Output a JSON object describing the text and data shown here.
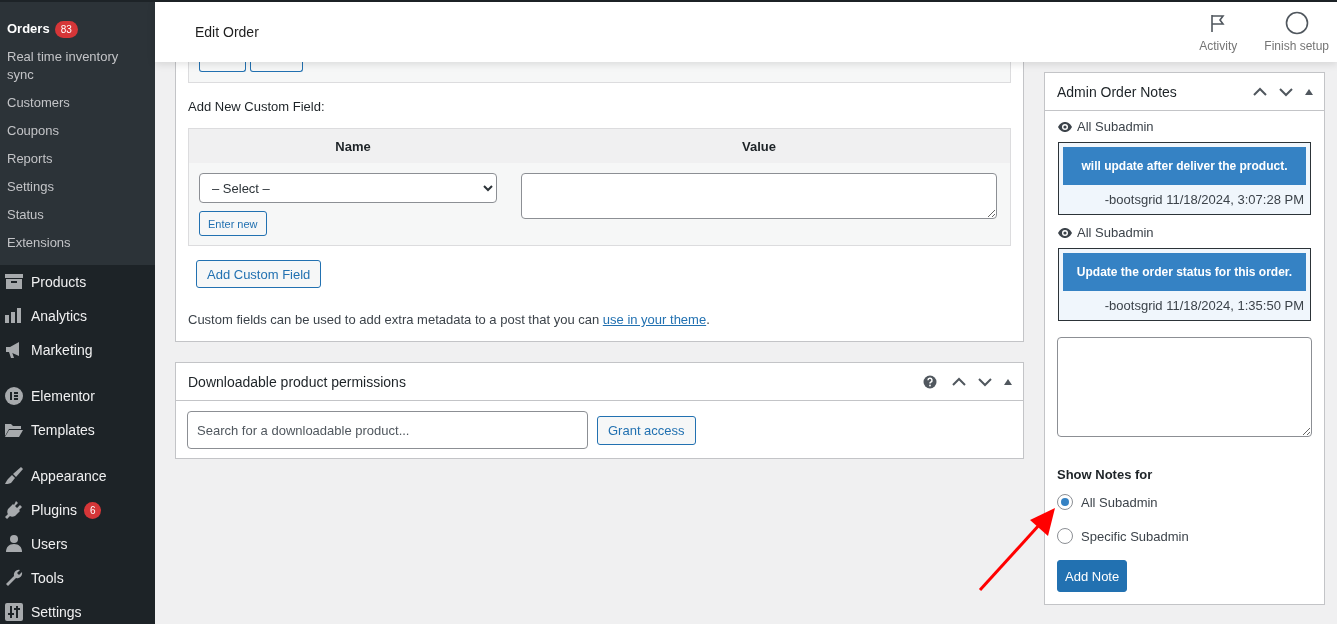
{
  "sidebar": {
    "submenu": [
      {
        "label": "Orders",
        "selected": true,
        "badge": "83"
      },
      {
        "label": "Real time inventory sync",
        "selected": false
      },
      {
        "label": "Customers",
        "selected": false
      },
      {
        "label": "Coupons",
        "selected": false
      },
      {
        "label": "Reports",
        "selected": false
      },
      {
        "label": "Settings",
        "selected": false
      },
      {
        "label": "Status",
        "selected": false
      },
      {
        "label": "Extensions",
        "selected": false
      }
    ],
    "menu_groups": [
      [
        {
          "label": "Products"
        },
        {
          "label": "Analytics"
        },
        {
          "label": "Marketing"
        }
      ],
      [
        {
          "label": "Elementor"
        },
        {
          "label": "Templates"
        }
      ],
      [
        {
          "label": "Appearance"
        },
        {
          "label": "Plugins",
          "badge": "6"
        },
        {
          "label": "Users"
        },
        {
          "label": "Tools"
        },
        {
          "label": "Settings"
        }
      ]
    ]
  },
  "header": {
    "title": "Edit Order",
    "actions": [
      {
        "label": "Activity"
      },
      {
        "label": "Finish setup"
      }
    ]
  },
  "custom_fields": {
    "heading": "Add New Custom Field:",
    "columns": [
      "Name",
      "Value"
    ],
    "select": {
      "value": "– Select –"
    },
    "enter_new": "Enter new",
    "add_button": "Add Custom Field",
    "help": {
      "text": "Custom fields can be used to add extra metadata to a post that you can ",
      "link": "use in your theme",
      "after": "."
    }
  },
  "downloads": {
    "title": "Downloadable product permissions",
    "search": {
      "placeholder": "Search for a downloadable product..."
    },
    "grant_button": "Grant access"
  },
  "notes_panel": {
    "title": "Admin Order Notes",
    "notes": [
      {
        "visibility": "All Subadmin",
        "text": "will update after deliver the product.",
        "meta": "-bootsgrid 11/18/2024, 3:07:28 PM"
      },
      {
        "visibility": "All Subadmin",
        "text": "Update the order status for this order.",
        "meta": "-bootsgrid 11/18/2024, 1:35:50 PM"
      }
    ],
    "show_for": {
      "label": "Show Notes for",
      "options": [
        {
          "label": "All Subadmin",
          "selected": true
        },
        {
          "label": "Specific Subadmin",
          "selected": false
        }
      ]
    },
    "add_button": "Add Note"
  }
}
